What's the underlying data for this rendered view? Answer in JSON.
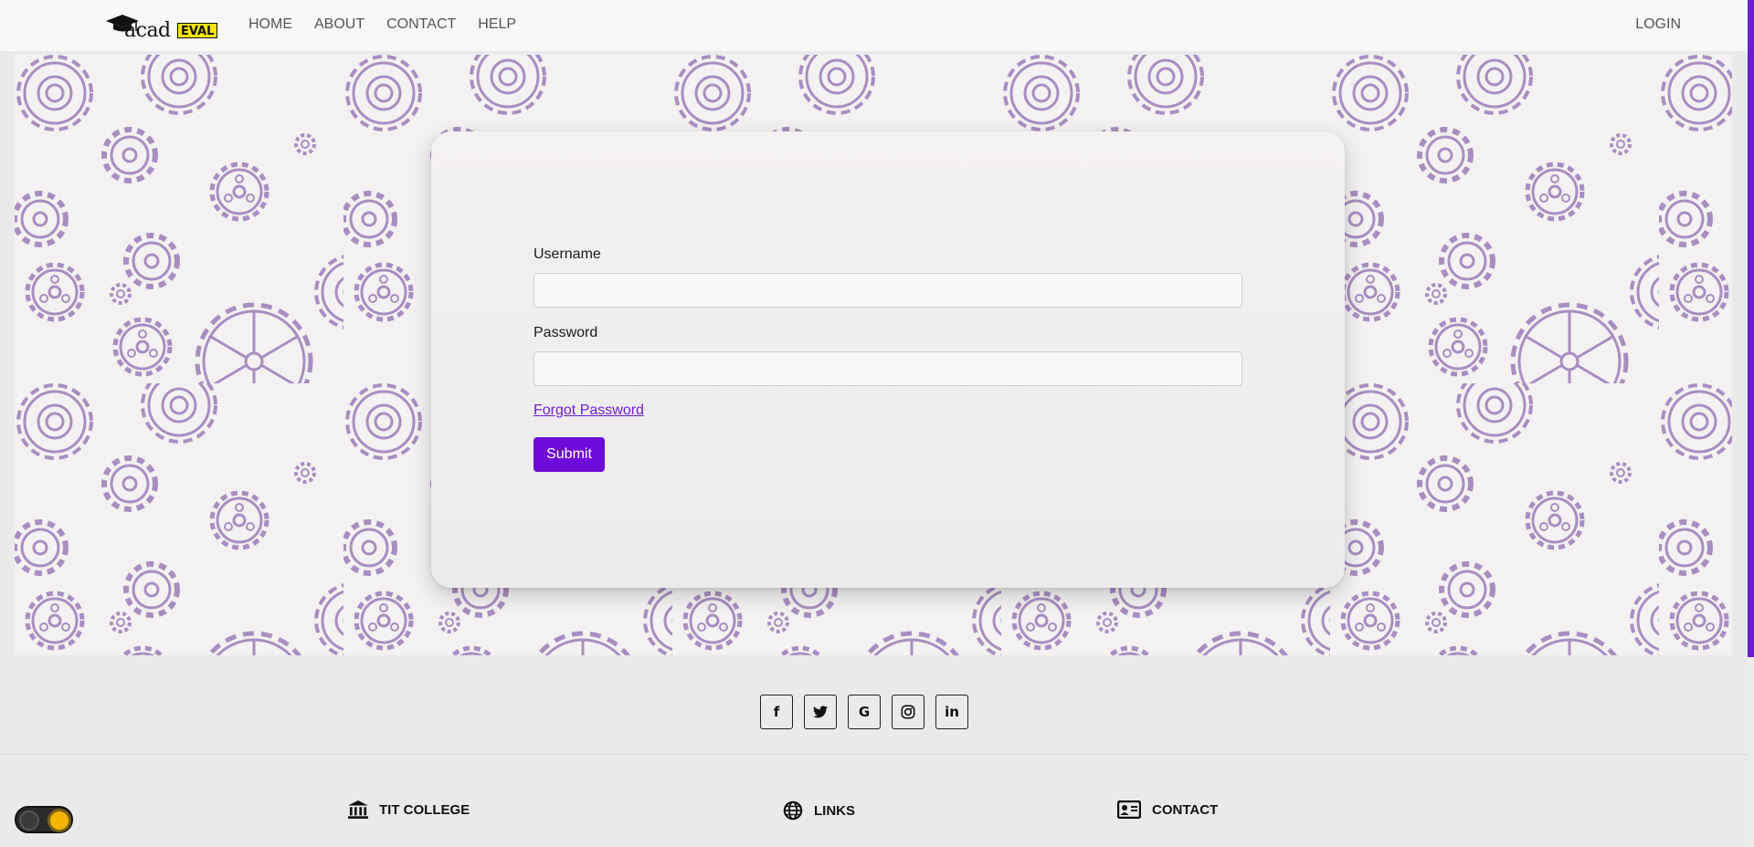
{
  "nav": {
    "logo_text": "acad",
    "logo_badge": "EVAL",
    "links": [
      "HOME",
      "ABOUT",
      "CONTACT",
      "HELP"
    ],
    "login": "LOGIN"
  },
  "form": {
    "username_label": "Username",
    "username_value": "",
    "password_label": "Password",
    "password_value": "",
    "forgot_label": "Forgot Password",
    "submit_label": "Submit"
  },
  "social": {
    "icons": [
      "facebook-icon",
      "twitter-icon",
      "google-icon",
      "instagram-icon",
      "linkedin-icon"
    ],
    "glyphs": [
      "f",
      "t",
      "G",
      "◎",
      "in"
    ]
  },
  "footer": {
    "college_title": "TIT COLLEGE",
    "links_title": "LINKS",
    "contact_title": "CONTACT"
  },
  "colors": {
    "accent": "#6d0cd8",
    "gear": "#a88ec0",
    "badge": "#f7e500"
  }
}
